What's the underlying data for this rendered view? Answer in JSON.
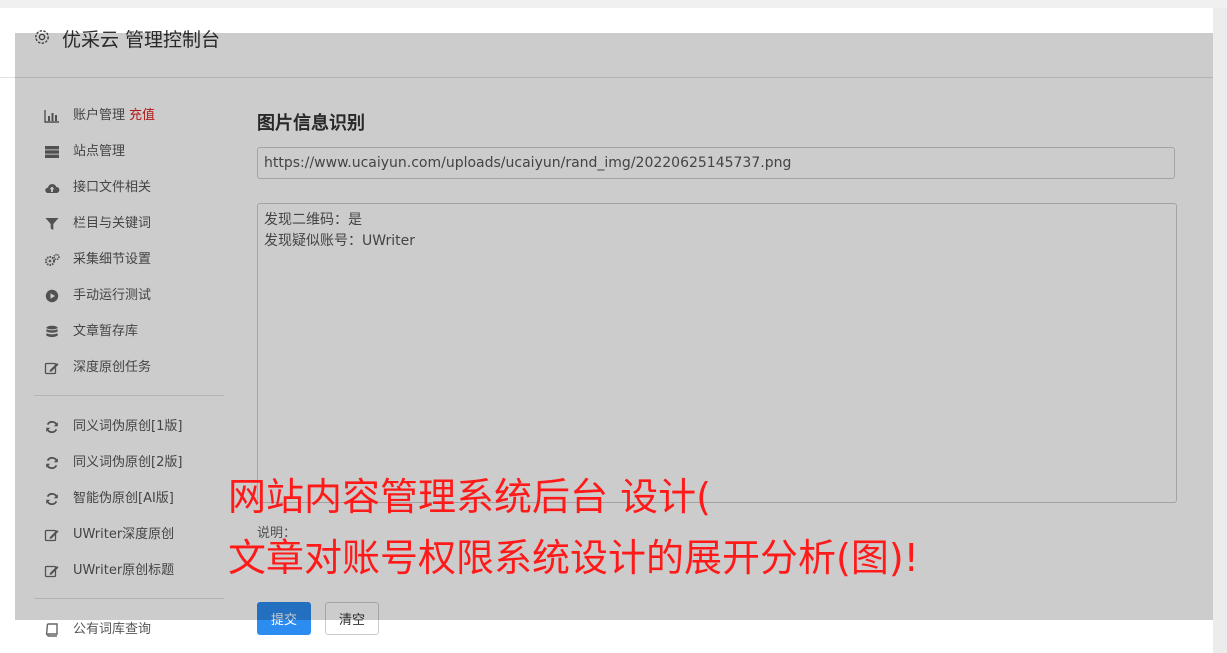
{
  "header": {
    "title": "优采云 管理控制台",
    "icon": "gear-icon"
  },
  "sidebar": {
    "group1": [
      {
        "label": "账户管理",
        "badge": "充值",
        "icon": "bar-chart-icon"
      },
      {
        "label": "站点管理",
        "icon": "server-icon"
      },
      {
        "label": "接口文件相关",
        "icon": "cloud-upload-icon"
      },
      {
        "label": "栏目与关键词",
        "icon": "filter-icon"
      },
      {
        "label": "采集细节设置",
        "icon": "gears-icon"
      },
      {
        "label": "手动运行测试",
        "icon": "play-circle-icon"
      },
      {
        "label": "文章暂存库",
        "icon": "database-icon"
      },
      {
        "label": "深度原创任务",
        "icon": "edit-icon"
      }
    ],
    "group2": [
      {
        "label": "同义词伪原创[1版]",
        "icon": "refresh-icon"
      },
      {
        "label": "同义词伪原创[2版]",
        "icon": "refresh-icon"
      },
      {
        "label": "智能伪原创[AI版]",
        "icon": "refresh-icon"
      },
      {
        "label": "UWriter深度原创",
        "icon": "edit-icon"
      },
      {
        "label": "UWriter原创标题",
        "icon": "edit-icon"
      }
    ],
    "group3": [
      {
        "label": "公有词库查询",
        "icon": "book-icon"
      }
    ]
  },
  "main": {
    "title": "图片信息识别",
    "url_value": "https://www.ucaiyun.com/uploads/ucaiyun/rand_img/20220625145737.png",
    "result_lines": [
      "发现二维码：是",
      "发现疑似账号：UWriter"
    ],
    "notes_label": "说明：",
    "submit_label": "提交",
    "clear_label": "清空"
  },
  "watermark": {
    "line1": "网站内容管理系统后台 设计(",
    "line2": "文章对账号权限系统设计的展开分析(图)!"
  },
  "colors": {
    "accent": "#2d8cf0",
    "badge": "#e02020",
    "watermark": "#ff1a1a"
  }
}
